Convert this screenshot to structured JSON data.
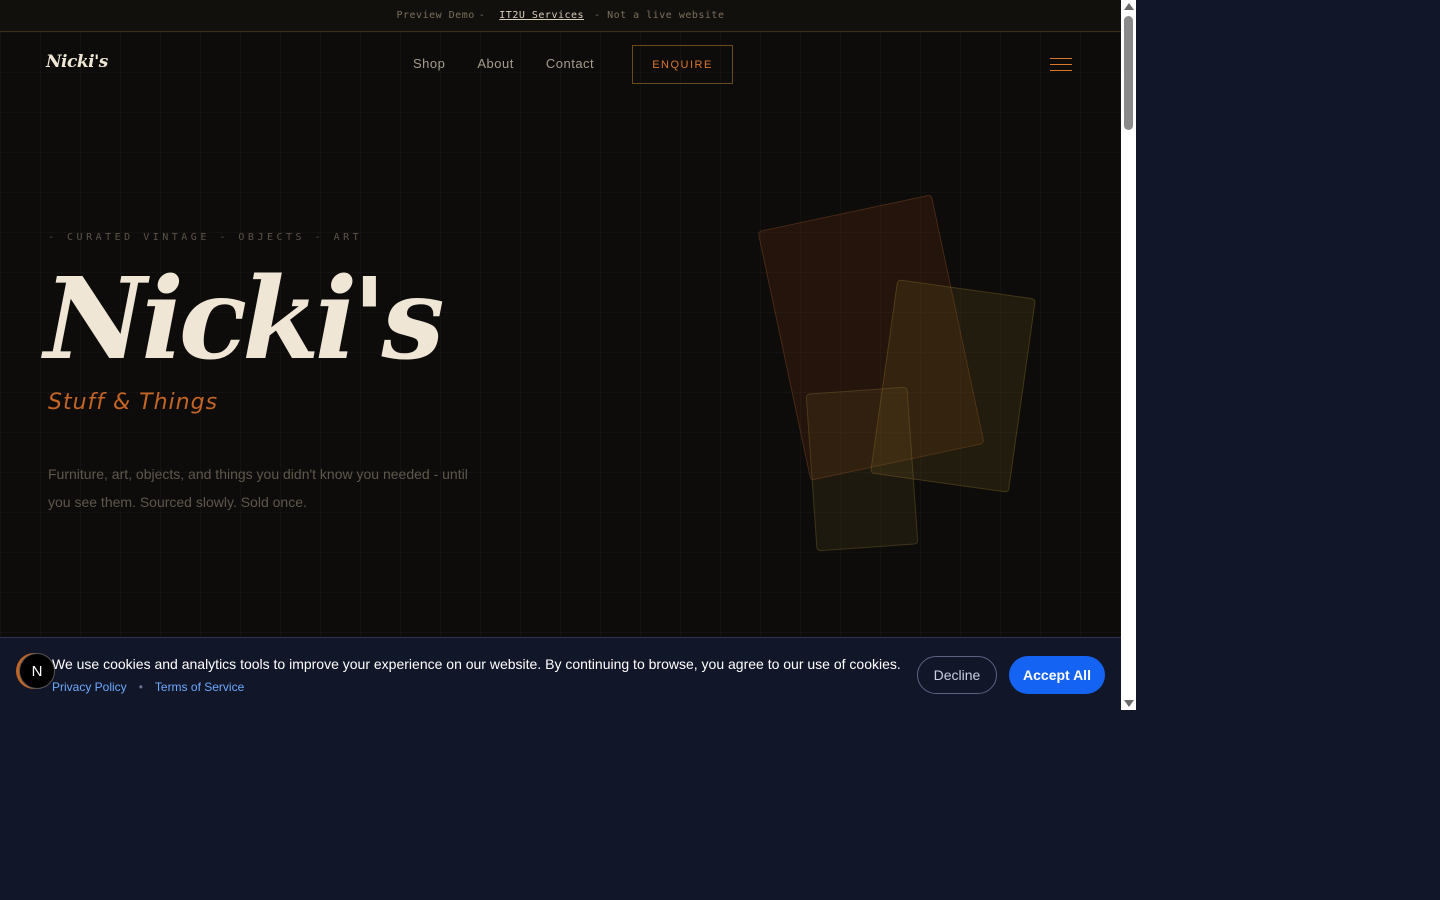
{
  "topbar": {
    "prefix": "Preview Demo",
    "sep1": "-",
    "link": "IT2U Services",
    "suffix": "- Not a live website"
  },
  "header": {
    "logo": "Nicki's",
    "nav": [
      "Shop",
      "About",
      "Contact"
    ],
    "enquire_label": "ENQUIRE",
    "menu_icon": "hamburger-icon"
  },
  "hero": {
    "eyebrow": "- CURATED VINTAGE - OBJECTS - ART",
    "title": "Nicki's",
    "subtitle": "Stuff & Things",
    "description": "Furniture, art, objects, and things you didn't know you needed - until you see them. Sourced slowly. Sold once."
  },
  "cookie": {
    "message": "We use cookies and analytics tools to improve your experience on our website. By continuing to browse, you agree to our use of cookies.",
    "privacy_link": "Privacy Policy",
    "dot": "•",
    "terms_link": "Terms of Service",
    "decline_label": "Decline",
    "accept_label": "Accept All"
  },
  "badge": {
    "letter": "N"
  },
  "colors": {
    "accent": "#d9772b",
    "background": "#0d0c0a",
    "cookie_bg": "#111729",
    "accept_button": "#1463f3"
  }
}
